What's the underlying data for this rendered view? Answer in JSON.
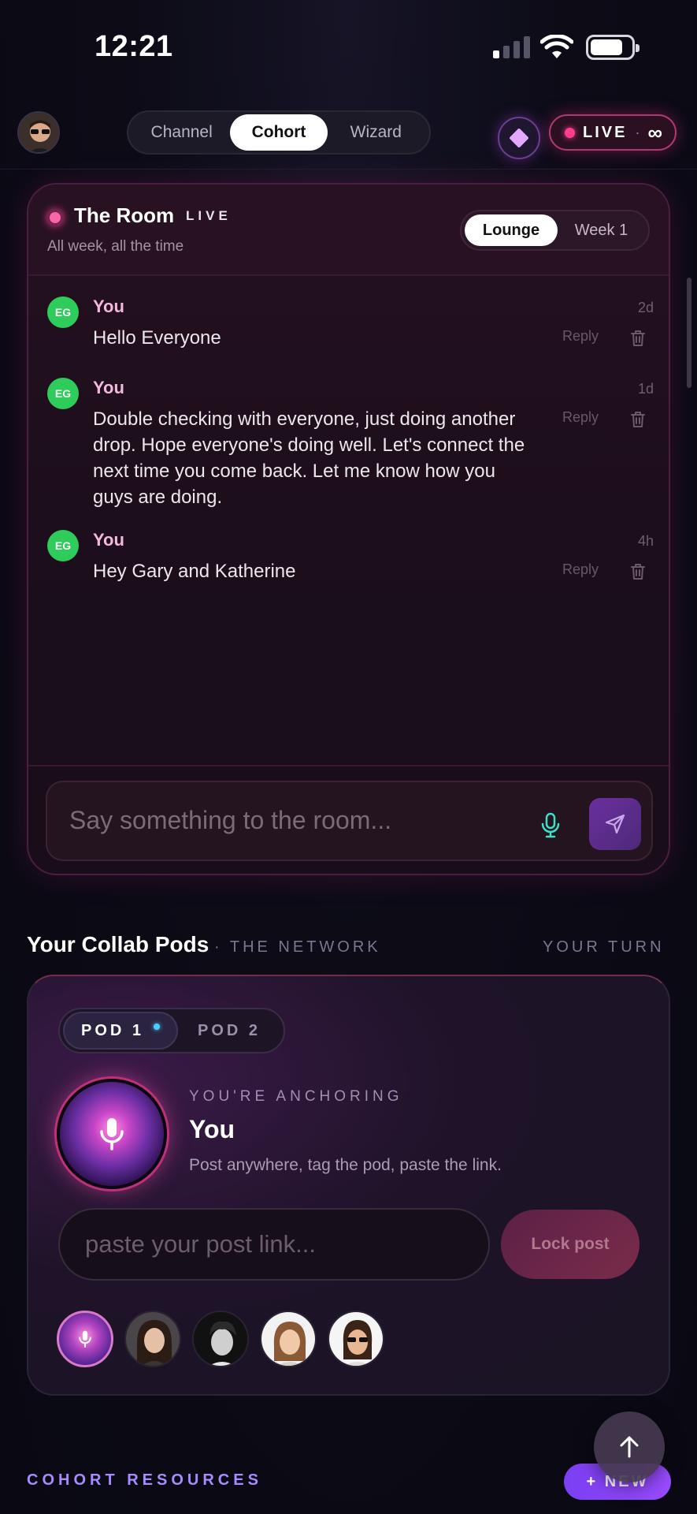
{
  "status_bar": {
    "time": "12:21"
  },
  "nav": {
    "tabs": [
      "Channel",
      "Cohort",
      "Wizard"
    ],
    "active_tab": "Cohort",
    "live_label": "LIVE",
    "live_separator": "·",
    "live_suffix": "∞"
  },
  "room": {
    "title": "The Room",
    "live_badge": "LIVE",
    "subtitle": "All week, all the time",
    "toggle": [
      "Lounge",
      "Week 1"
    ],
    "messages": [
      {
        "initials": "EG",
        "author": "You",
        "text": "Hello Everyone",
        "time": "2d",
        "reply": "Reply"
      },
      {
        "initials": "EG",
        "author": "You",
        "text": "Double checking with everyone, just doing another drop. Hope everyone's doing well. Let's connect the next time you come back. Let me know how you guys are doing.",
        "time": "1d",
        "reply": "Reply"
      },
      {
        "initials": "EG",
        "author": "You",
        "text": "Hey Gary and Katherine",
        "time": "4h",
        "reply": "Reply"
      }
    ],
    "input_placeholder": "Say something to the room..."
  },
  "pods": {
    "title": "Your Collab Pods",
    "subtitle": "· THE NETWORK",
    "turn": "YOUR TURN",
    "tabs": [
      "POD 1",
      "POD 2"
    ],
    "anchoring_label": "YOU'RE ANCHORING",
    "anchor_name": "You",
    "anchor_desc": "Post anywhere, tag the pod, paste the link.",
    "link_placeholder": "paste your post link...",
    "lock_label": "Lock post"
  },
  "resources": {
    "title": "COHORT RESOURCES",
    "new_label": "+ NEW"
  },
  "colors": {
    "accent_pink": "#ff3d8f",
    "accent_purple": "#9a4bff",
    "avatar_green": "#2ecc5a"
  }
}
